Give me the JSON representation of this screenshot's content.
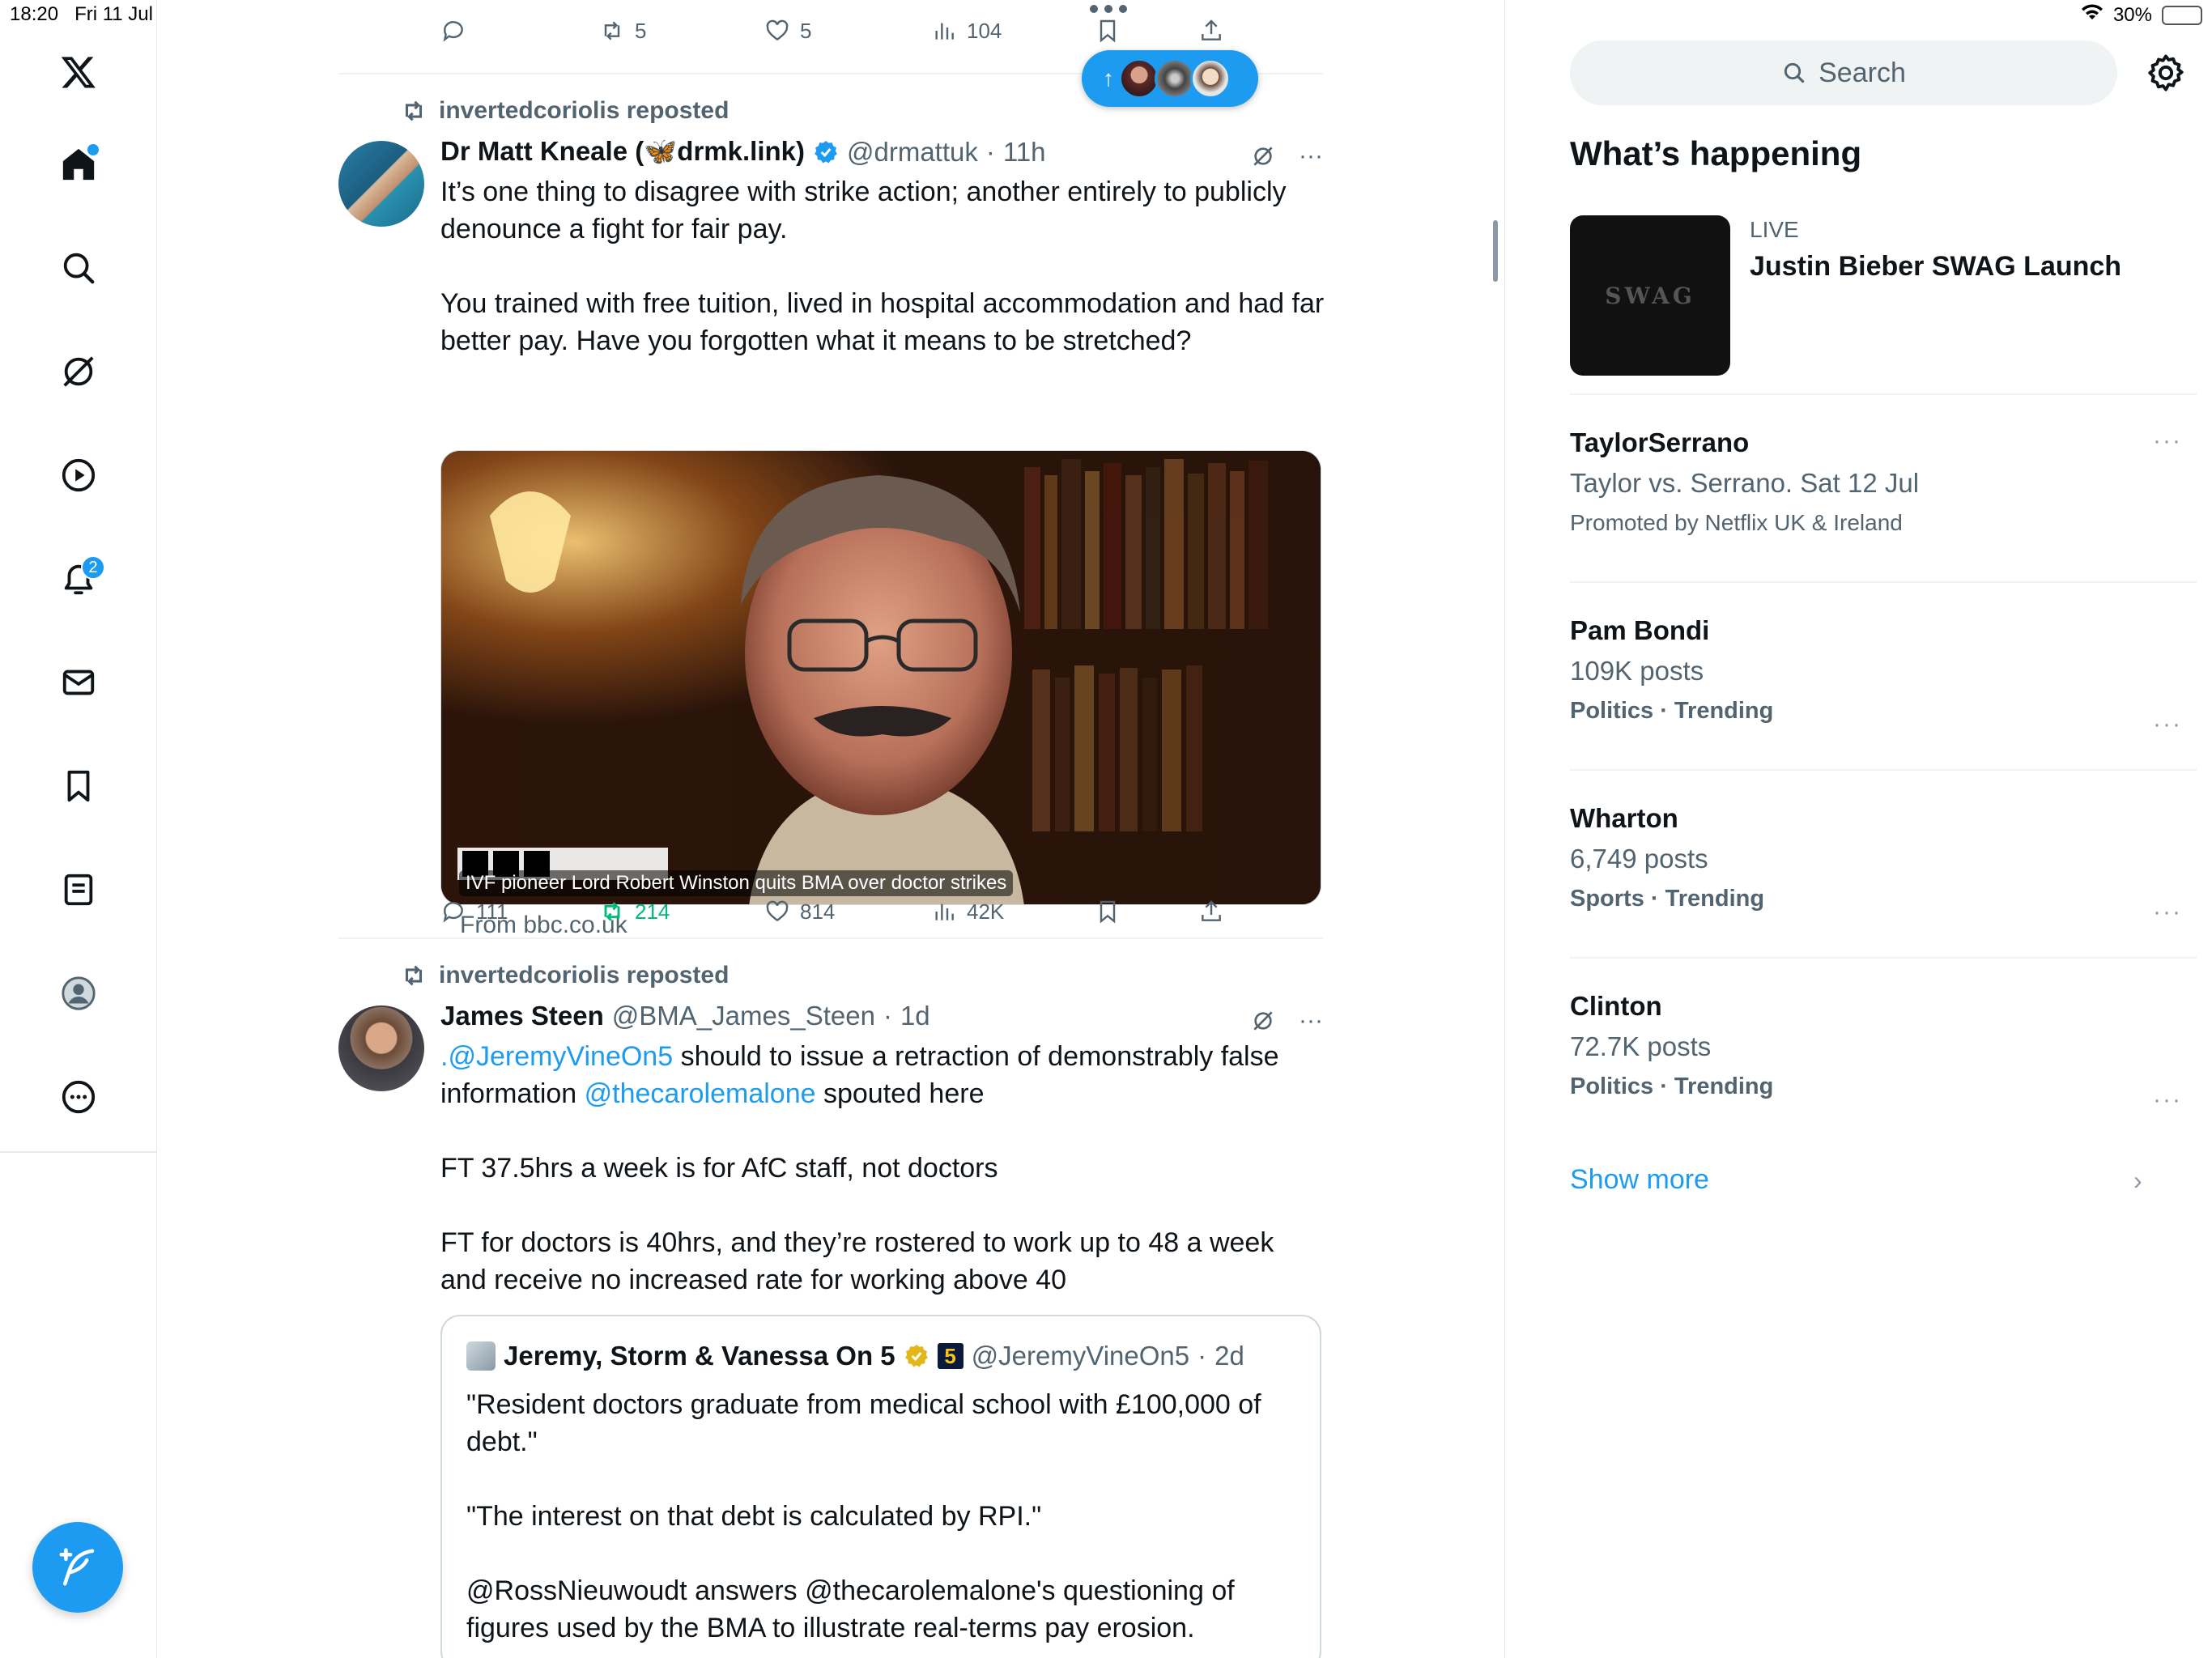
{
  "status": {
    "time": "18:20",
    "date": "Fri 11 Jul",
    "battery": "30%",
    "battery_level": 0.3
  },
  "nav": {
    "notifications_badge": "2"
  },
  "colors": {
    "accent": "#1d9bf0",
    "repost_green": "#00ba7c",
    "secondary_text": "#536471"
  },
  "top_actions": {
    "replies": "",
    "reposts": "5",
    "likes": "5",
    "views": "104"
  },
  "post1": {
    "repost_by": "invertedcoriolis reposted",
    "name": "Dr Matt Kneale (🦋drmk.link)",
    "handle": "@drmattuk",
    "time": "11h",
    "text1": "It’s one thing to disagree with strike action; another entirely to publicly denounce a fight for fair pay.",
    "text2": "You trained with free tuition, lived in hospital accommodation and had far better pay. Have you forgotten what it means to be stretched?",
    "card_caption": "IVF pioneer Lord Robert Winston quits BMA over doctor strikes",
    "card_from": "From bbc.co.uk",
    "replies": "111",
    "reposts": "214",
    "likes": "814",
    "views": "42K"
  },
  "post2": {
    "repost_by": "invertedcoriolis reposted",
    "name": "James Steen",
    "handle": "@BMA_James_Steen",
    "time": "1d",
    "mention1": ".@JeremyVineOn5",
    "text1a": " should to issue a retraction of demonstrably false information ",
    "mention2": "@thecarolemalone",
    "text1b": " spouted here",
    "text2": "FT 37.5hrs a week is for AfC staff, not doctors",
    "text3": "FT for doctors is 40hrs, and they’re rostered to work up to 48 a week and receive no increased rate for working above 40",
    "quote": {
      "name": "Jeremy, Storm & Vanessa On 5",
      "channel_badge": "5",
      "handle": "@JeremyVineOn5",
      "time": "2d",
      "text1": "\"Resident doctors graduate from medical school with £100,000 of debt.\"",
      "text2": "\"The interest on that debt is calculated by RPI.\"",
      "text3": "@RossNieuwoudt answers @thecarolemalone's questioning of figures used by the BMA to illustrate real-terms pay erosion."
    }
  },
  "sidebar": {
    "search_placeholder": "Search",
    "title": "What’s happening",
    "live": {
      "thumb_text": "SWAG",
      "label": "LIVE",
      "title": "Justin Bieber SWAG Launch"
    },
    "trends": [
      {
        "title": "TaylorSerrano",
        "subtitle": "Taylor vs. Serrano. Sat 12 Jul",
        "category": "Promoted by Netflix UK & Ireland"
      },
      {
        "title": "Pam Bondi",
        "subtitle": "109K posts",
        "category": "Politics · Trending"
      },
      {
        "title": "Wharton",
        "subtitle": "6,749 posts",
        "category": "Sports · Trending"
      },
      {
        "title": "Clinton",
        "subtitle": "72.7K posts",
        "category": "Politics · Trending"
      }
    ],
    "show_more": "Show more"
  }
}
